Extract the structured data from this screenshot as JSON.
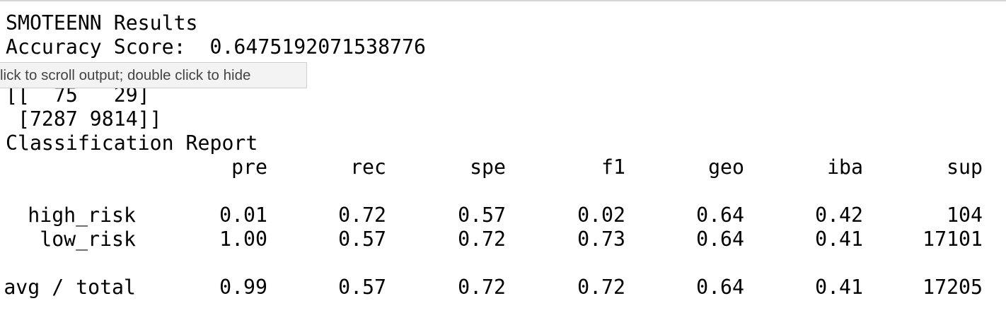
{
  "output": {
    "title": "SMOTEENN Results",
    "accuracy_line": "Accuracy Score:  0.6475192071538776",
    "confusion_row_1": "[[  75   29]",
    "confusion_row_2": " [7287 9814]]",
    "report_heading": "Classification Report"
  },
  "tooltip": {
    "text": "lick to scroll output; double click to hide"
  },
  "report": {
    "headers": [
      "pre",
      "rec",
      "spe",
      "f1",
      "geo",
      "iba",
      "sup"
    ],
    "rows": [
      {
        "label": "high_risk",
        "values": [
          "0.01",
          "0.72",
          "0.57",
          "0.02",
          "0.64",
          "0.42",
          "104"
        ]
      },
      {
        "label": "low_risk",
        "values": [
          "1.00",
          "0.57",
          "0.72",
          "0.73",
          "0.64",
          "0.41",
          "17101"
        ]
      }
    ],
    "total": {
      "label": "avg / total",
      "values": [
        "0.99",
        "0.57",
        "0.72",
        "0.72",
        "0.64",
        "0.41",
        "17205"
      ]
    }
  }
}
